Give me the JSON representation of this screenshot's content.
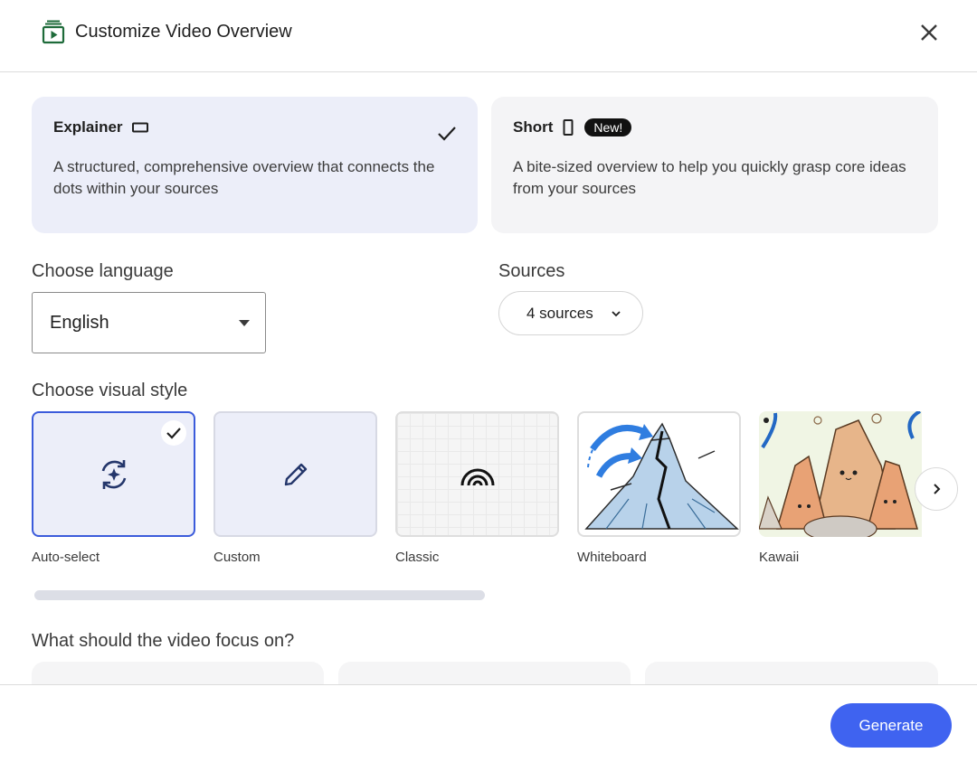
{
  "dialog": {
    "title": "Customize Video Overview",
    "title_icon": "video-overview-icon",
    "close_icon": "close-icon"
  },
  "formats": [
    {
      "title": "Explainer",
      "icon": "landscape-rectangle-icon",
      "description": "A structured, comprehensive overview that connects the dots within your sources",
      "selected": true
    },
    {
      "title": "Short",
      "icon": "portrait-rectangle-icon",
      "badge": "New!",
      "description": "A bite-sized overview to help you quickly grasp core ideas from your sources",
      "selected": false
    }
  ],
  "language": {
    "label": "Choose language",
    "value": "English"
  },
  "sources": {
    "label": "Sources",
    "value": "4 sources"
  },
  "visual_style": {
    "label": "Choose visual style",
    "styles": [
      {
        "label": "Auto-select",
        "icon": "auto-select-sparkle-icon",
        "selected": true
      },
      {
        "label": "Custom",
        "icon": "pencil-icon",
        "selected": false
      },
      {
        "label": "Classic",
        "icon": "rainbow-arcs-icon",
        "selected": false
      },
      {
        "label": "Whiteboard",
        "icon": "volcano-sketch-thumbnail",
        "selected": false
      },
      {
        "label": "Kawaii",
        "icon": "kawaii-mountains-thumbnail",
        "selected": false
      }
    ],
    "next_icon": "chevron-right-icon"
  },
  "focus": {
    "label": "What should the video focus on?"
  },
  "footer": {
    "generate_label": "Generate"
  },
  "colors": {
    "accent": "#3f63f0",
    "selected_card": "#eceef9",
    "selected_border": "#3b5bdb"
  }
}
